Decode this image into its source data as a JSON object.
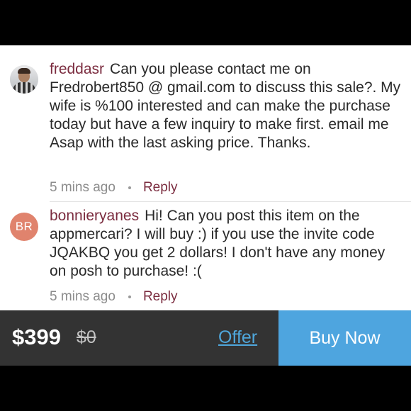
{
  "comments": [
    {
      "username": "freddasr",
      "text": "Can you please contact me on Fredrobert850 @ gmail.com to discuss this sale?. My wife is  %100 interested and can make the purchase today but have a few inquiry to make first. email me Asap with the last asking price. Thanks.",
      "time": "5 mins ago",
      "reply_label": "Reply",
      "avatar_type": "photo"
    },
    {
      "username": "bonnieryanes",
      "text": "Hi! Can you post this item on the appmercari? I will buy :) if you use the invite code JQAKBQ you get 2 dollars! I don't have any money on posh to purchase! :(",
      "time": "5 mins ago",
      "reply_label": "Reply",
      "avatar_initials": "BR"
    }
  ],
  "purchase_bar": {
    "price": "$399",
    "original_price": "$0",
    "offer_label": "Offer",
    "buy_label": "Buy Now"
  },
  "colors": {
    "username": "#7b2c3f",
    "accent_blue": "#4ea5df",
    "bar_background": "#333333",
    "initials_avatar": "#e0836d"
  }
}
